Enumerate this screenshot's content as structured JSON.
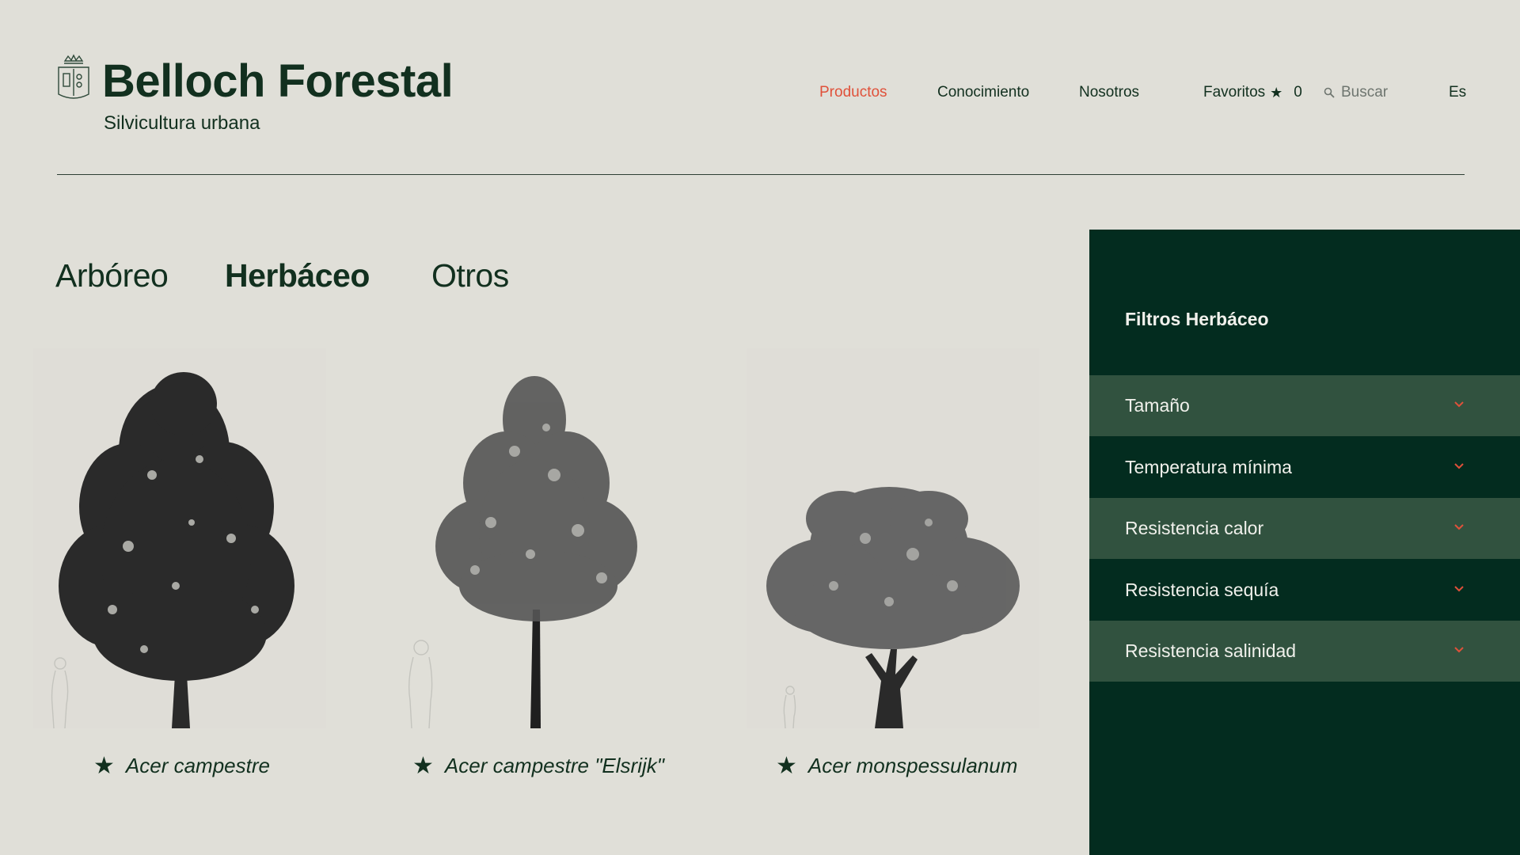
{
  "brand": {
    "title": "Belloch Forestal",
    "subtitle": "Silvicultura urbana"
  },
  "nav": {
    "items": [
      "Productos",
      "Conocimiento",
      "Nosotros"
    ],
    "active": "Productos",
    "favorites_label": "Favoritos",
    "favorites_count": "0",
    "search_placeholder": "Buscar",
    "language": "Es"
  },
  "tabs": {
    "items": [
      "Arbóreo",
      "Herbáceo",
      "Otros"
    ],
    "active": "Herbáceo"
  },
  "products": [
    {
      "name": "Acer campestre",
      "favorite_icon": "star-icon"
    },
    {
      "name": "Acer campestre \"Elsrijk\"",
      "favorite_icon": "star-icon"
    },
    {
      "name": "Acer monspessulanum",
      "favorite_icon": "star-icon"
    }
  ],
  "filters": {
    "title": "Filtros Herbáceo",
    "items": [
      "Tamaño",
      "Temperatura mínima",
      "Resistencia calor",
      "Resistencia sequía",
      "Resistencia salinidad"
    ]
  },
  "colors": {
    "background": "#e0dfd8",
    "brand_dark": "#12301f",
    "accent": "#e0513a",
    "panel": "#032c1f",
    "panel_row_light": "#31523f"
  }
}
